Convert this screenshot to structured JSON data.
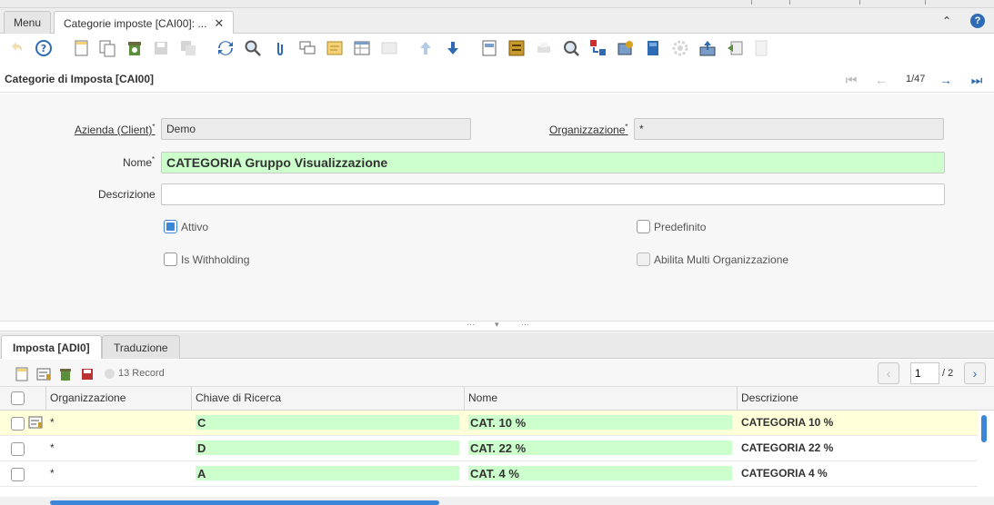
{
  "window_tabs": [
    {
      "label": "Menu"
    },
    {
      "label": "Categorie imposte [CAI00]: ...",
      "close": "✕"
    }
  ],
  "record_header": {
    "title": "Categorie di Imposta [CAI00]",
    "record_position": "1/47"
  },
  "form": {
    "client_label": "Azienda (Client)",
    "client_value": "Demo",
    "org_label": "Organizzazione",
    "org_value": "*",
    "name_label": "Nome",
    "name_value": "CATEGORIA Gruppo Visualizzazione",
    "description_label": "Descrizione",
    "description_value": "",
    "active_label": "Attivo",
    "active_checked": true,
    "default_label": "Predefinito",
    "default_checked": false,
    "withholding_label": "Is Withholding",
    "withholding_checked": false,
    "multiorg_label": "Abilita Multi Organizzazione",
    "multiorg_checked": false,
    "required_marker": "*"
  },
  "detail_tabs": [
    {
      "label": "Imposta [ADI0]"
    },
    {
      "label": "Traduzione"
    }
  ],
  "grid_toolbar": {
    "record_count": "13 Record",
    "page_value": "1",
    "page_total": "/ 2"
  },
  "grid": {
    "columns": [
      "Organizzazione",
      "Chiave di Ricerca",
      "Nome",
      "Descrizione"
    ],
    "rows": [
      {
        "org": "*",
        "key": "C",
        "name": "CAT. 10 %",
        "description": "CATEGORIA 10 %"
      },
      {
        "org": "*",
        "key": "D",
        "name": "CAT. 22 %",
        "description": "CATEGORIA 22 %"
      },
      {
        "org": "*",
        "key": "A",
        "name": "CAT. 4 %",
        "description": "CATEGORIA 4 %"
      }
    ]
  },
  "colors": {
    "accent": "#3b86d9",
    "mandatory_bg": "#ccffcc",
    "selected_row_bg": "#ffffd9",
    "readonly_bg": "#ebebeb"
  },
  "icons": {
    "help": "?",
    "collapse": "⌃",
    "first": "⏮",
    "prev": "←",
    "next": "→",
    "last": "⏭",
    "page_prev": "‹",
    "page_next": "›"
  }
}
